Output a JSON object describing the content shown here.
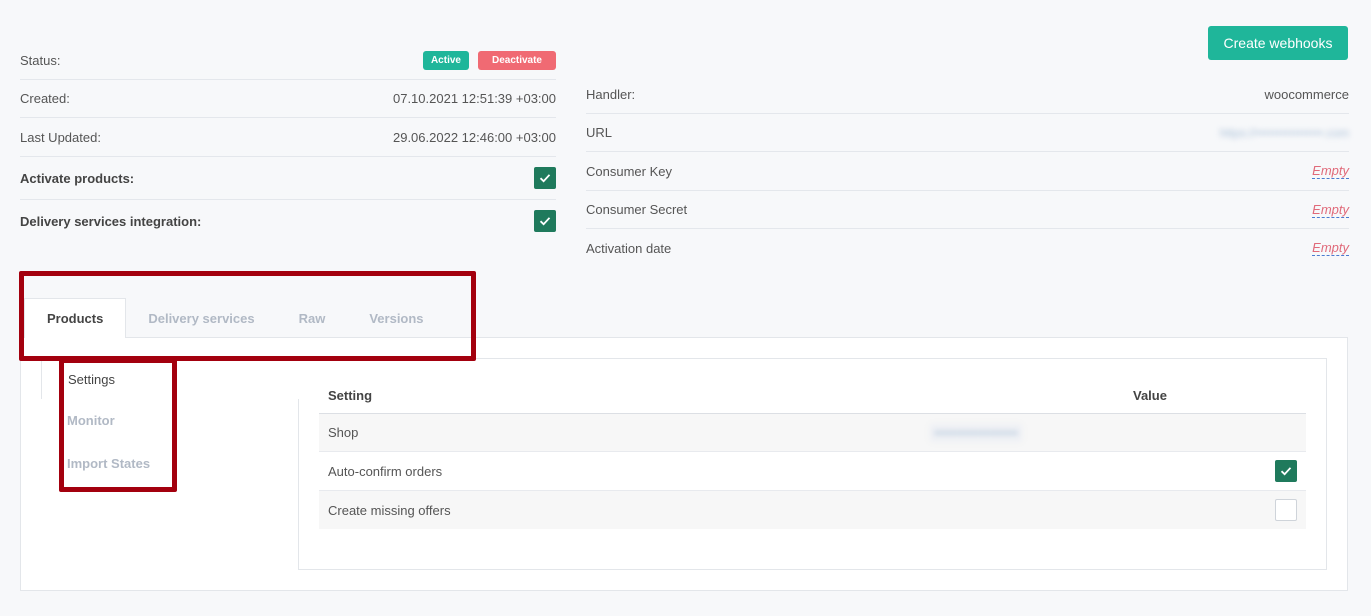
{
  "left_info": {
    "status_label": "Status:",
    "status_badge": "Active",
    "deactivate_label": "Deactivate",
    "created_label": "Created:",
    "created_value": "07.10.2021 12:51:39 +03:00",
    "updated_label": "Last Updated:",
    "updated_value": "29.06.2022 12:46:00 +03:00",
    "activate_products_label": "Activate products:",
    "activate_products_checked": true,
    "delivery_integration_label": "Delivery services integration:",
    "delivery_integration_checked": true
  },
  "right_info": {
    "create_webhooks_label": "Create webhooks",
    "handler_label": "Handler:",
    "handler_value": "woocommerce",
    "url_label": "URL",
    "url_value": "https://••••••••••••••••.com",
    "consumer_key_label": "Consumer Key",
    "consumer_key_value": "Empty",
    "consumer_secret_label": "Consumer Secret",
    "consumer_secret_value": "Empty",
    "activation_date_label": "Activation date",
    "activation_date_value": "Empty"
  },
  "tabs": [
    {
      "label": "Products",
      "active": true
    },
    {
      "label": "Delivery services",
      "active": false
    },
    {
      "label": "Raw",
      "active": false
    },
    {
      "label": "Versions",
      "active": false
    }
  ],
  "subnav": [
    {
      "label": "Settings",
      "active": true
    },
    {
      "label": "Monitor",
      "active": false
    },
    {
      "label": "Import States",
      "active": false
    }
  ],
  "settings_table": {
    "header_setting": "Setting",
    "header_value": "Value",
    "rows": [
      {
        "setting": "Shop",
        "value": "••••••••••••••••••••"
      },
      {
        "setting": "Auto-confirm orders",
        "checked": true
      },
      {
        "setting": "Create missing offers",
        "checked": false
      }
    ]
  },
  "colors": {
    "accent": "#1fb69a",
    "danger": "#f06a73",
    "check": "#1f7a5c",
    "highlight_box": "#a3000e"
  }
}
